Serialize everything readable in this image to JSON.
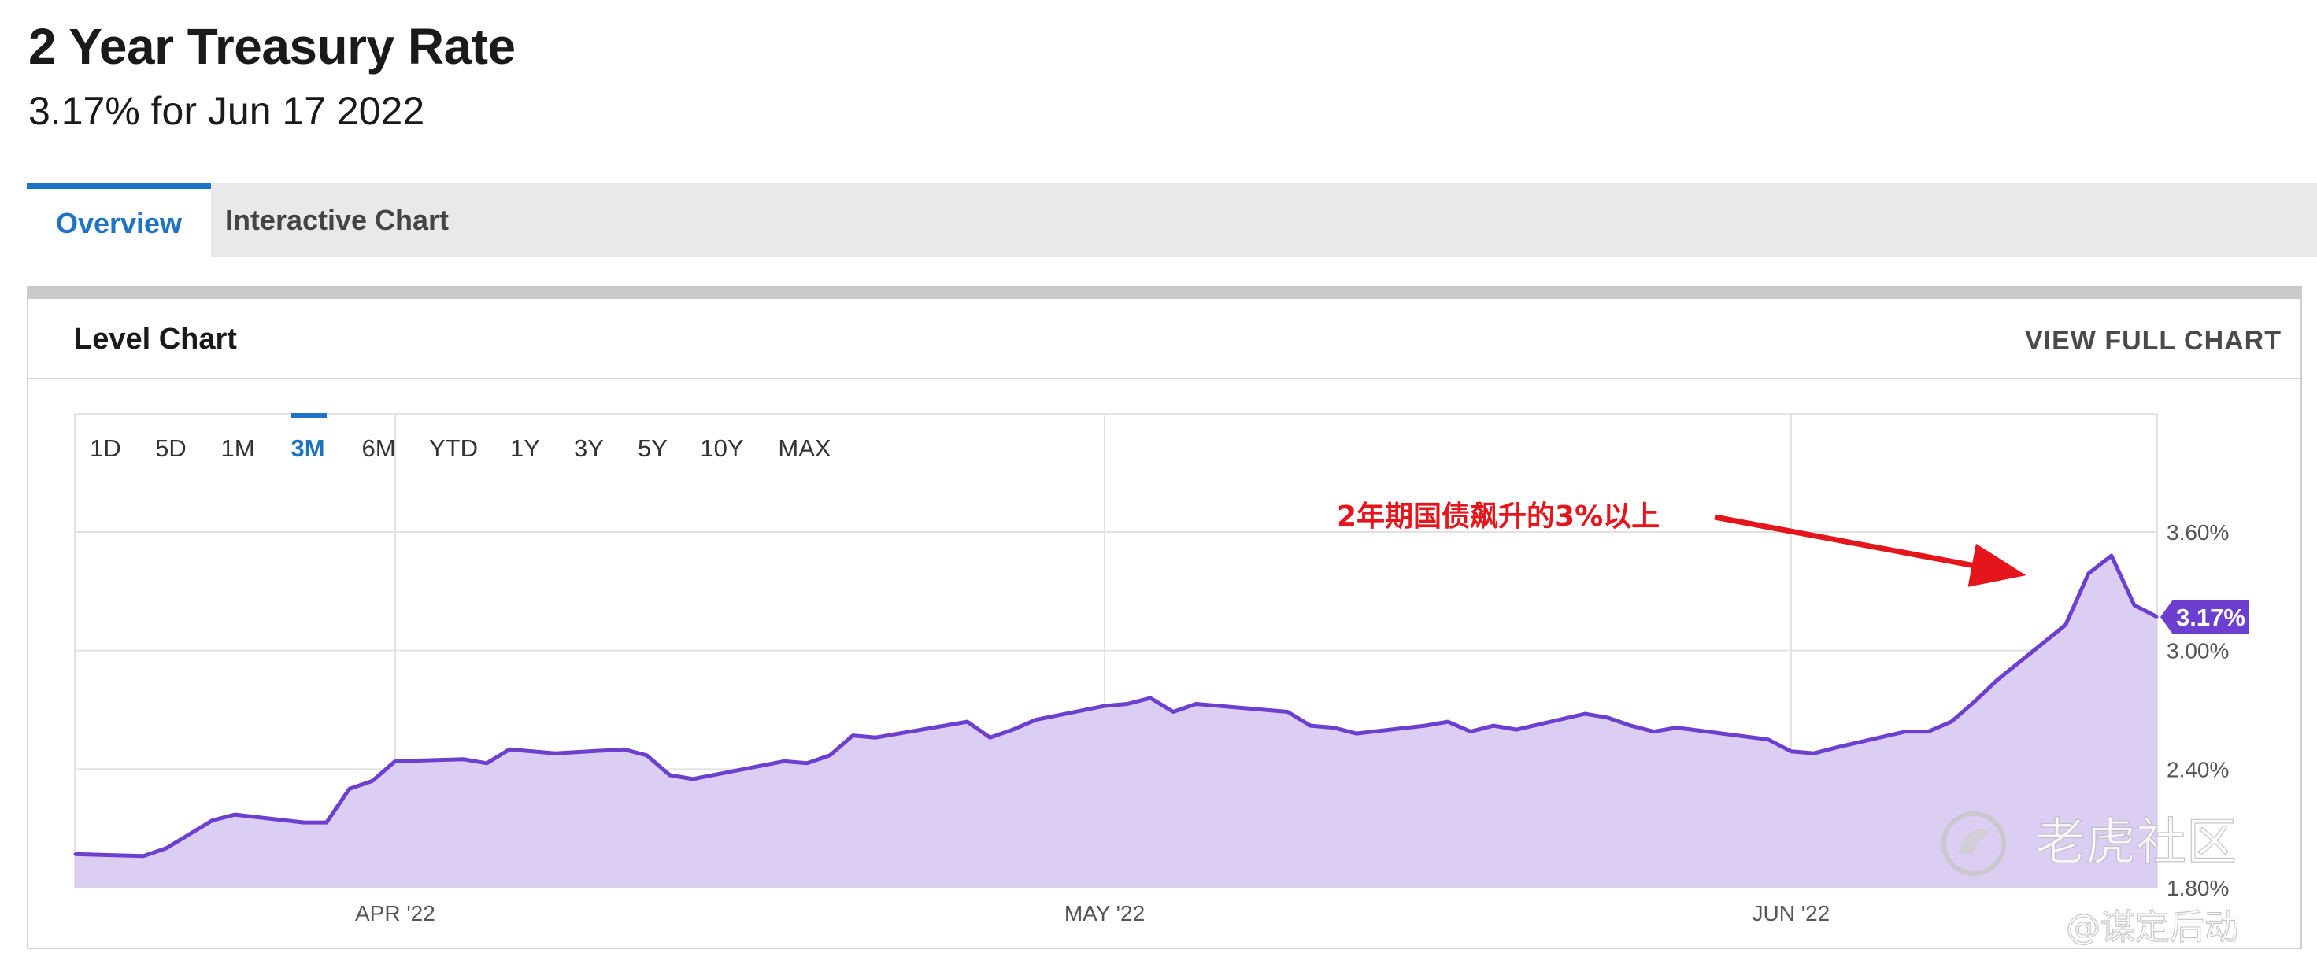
{
  "header": {
    "title": "2 Year Treasury Rate",
    "subtitle": "3.17% for Jun 17 2022"
  },
  "tabs": [
    {
      "label": "Overview",
      "active": true
    },
    {
      "label": "Interactive Chart",
      "active": false
    }
  ],
  "panel": {
    "title": "Level Chart",
    "full_chart_label": "VIEW FULL CHART"
  },
  "ranges": [
    {
      "label": "1D"
    },
    {
      "label": "5D"
    },
    {
      "label": "1M"
    },
    {
      "label": "3M",
      "active": true
    },
    {
      "label": "6M"
    },
    {
      "label": "YTD"
    },
    {
      "label": "1Y"
    },
    {
      "label": "3Y"
    },
    {
      "label": "5Y"
    },
    {
      "label": "10Y"
    },
    {
      "label": "MAX"
    }
  ],
  "annotation": {
    "text": "2年期国债飙升的3%以上"
  },
  "watermark": {
    "brand": "老虎社区",
    "handle": "@谋定后动"
  },
  "chart_data": {
    "type": "area",
    "series": [
      {
        "x": [
          "2022-03-18",
          "2022-03-21",
          "2022-03-22",
          "2022-03-23",
          "2022-03-24",
          "2022-03-25",
          "2022-03-28",
          "2022-03-29",
          "2022-03-30",
          "2022-03-31",
          "2022-04-01",
          "2022-04-04",
          "2022-04-05",
          "2022-04-06",
          "2022-04-07",
          "2022-04-08",
          "2022-04-11",
          "2022-04-12",
          "2022-04-13",
          "2022-04-14",
          "2022-04-18",
          "2022-04-19",
          "2022-04-20",
          "2022-04-21",
          "2022-04-22",
          "2022-04-25",
          "2022-04-26",
          "2022-04-27",
          "2022-04-28",
          "2022-04-29",
          "2022-05-02",
          "2022-05-03",
          "2022-05-04",
          "2022-05-05",
          "2022-05-06",
          "2022-05-09",
          "2022-05-10",
          "2022-05-11",
          "2022-05-12",
          "2022-05-13",
          "2022-05-16",
          "2022-05-17",
          "2022-05-18",
          "2022-05-19",
          "2022-05-20",
          "2022-05-23",
          "2022-05-24",
          "2022-05-25",
          "2022-05-26",
          "2022-05-27",
          "2022-05-31",
          "2022-06-01",
          "2022-06-02",
          "2022-06-03",
          "2022-06-06",
          "2022-06-07",
          "2022-06-08",
          "2022-06-09",
          "2022-06-10",
          "2022-06-13",
          "2022-06-14",
          "2022-06-15",
          "2022-06-16",
          "2022-06-17"
        ],
        "values": [
          1.97,
          1.96,
          2.0,
          2.07,
          2.14,
          2.17,
          2.13,
          2.13,
          2.3,
          2.34,
          2.44,
          2.45,
          2.43,
          2.5,
          2.49,
          2.48,
          2.5,
          2.47,
          2.37,
          2.35,
          2.44,
          2.43,
          2.47,
          2.57,
          2.56,
          2.62,
          2.64,
          2.56,
          2.6,
          2.65,
          2.72,
          2.73,
          2.76,
          2.69,
          2.73,
          2.7,
          2.69,
          2.62,
          2.61,
          2.58,
          2.62,
          2.64,
          2.59,
          2.62,
          2.6,
          2.68,
          2.66,
          2.62,
          2.59,
          2.61,
          2.55,
          2.49,
          2.48,
          2.51,
          2.59,
          2.59,
          2.64,
          2.74,
          2.85,
          3.13,
          3.39,
          3.48,
          3.23,
          3.17
        ]
      }
    ],
    "x_ticks": [
      "APR '22",
      "MAY '22",
      "JUN '22"
    ],
    "x_tick_dates": [
      "2022-04-01",
      "2022-05-02",
      "2022-06-01"
    ],
    "y_ticks": [
      "3.60%",
      "3.00%",
      "2.40%",
      "1.80%"
    ],
    "y_tick_values": [
      3.6,
      3.0,
      2.4,
      1.8
    ],
    "ylim": [
      1.8,
      3.6
    ],
    "last_value_label": "3.17%",
    "line_color": "#6c3fcf",
    "fill_color": "#dccdf3",
    "grid": true
  }
}
